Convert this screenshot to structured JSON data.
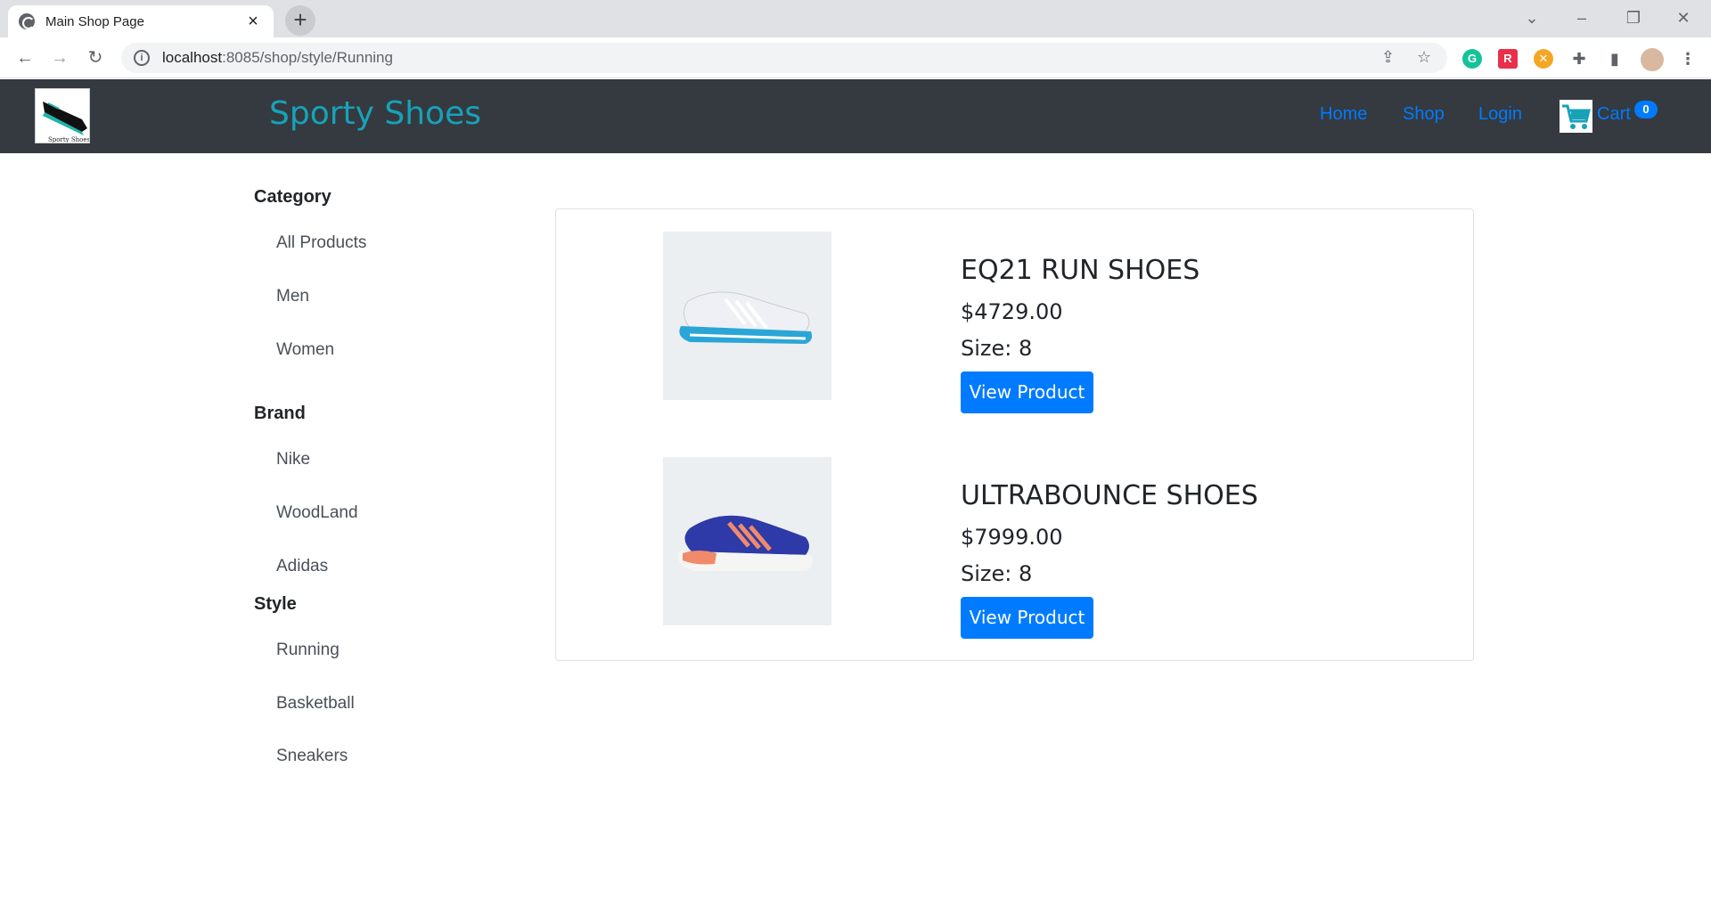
{
  "browser": {
    "tab_title": "Main Shop Page",
    "url_host": "localhost",
    "url_rest": ":8085/shop/style/Running",
    "colors": {
      "tabstrip": "#dfe1e5",
      "omnibox": "#f1f3f4"
    },
    "extensions": [
      {
        "name": "grammarly-icon",
        "glyph": "G",
        "color": "#15c39a"
      },
      {
        "name": "extension-red-icon",
        "glyph": "R",
        "color": "#e8304a"
      },
      {
        "name": "extension-yellow-icon",
        "glyph": "✕",
        "color": "#f5a623"
      }
    ]
  },
  "site": {
    "brand": "Sporty Shoes",
    "logo_caption": "Sporty Shoes",
    "nav": {
      "home": "Home",
      "shop": "Shop",
      "login": "Login",
      "cart": "Cart"
    },
    "cart_count": "0",
    "colors": {
      "navbar": "#343a40",
      "brand": "#17a2b8",
      "link": "#007bff",
      "cart_icon": "#17a2b8"
    }
  },
  "sidebar": {
    "category": {
      "heading": "Category",
      "items": [
        "All Products",
        "Men",
        "Women"
      ]
    },
    "brand": {
      "heading": "Brand",
      "items": [
        "Nike",
        "WoodLand",
        "Adidas"
      ]
    },
    "style": {
      "heading": "Style",
      "items": [
        "Running",
        "Basketball",
        "Sneakers"
      ]
    }
  },
  "products": [
    {
      "name": "EQ21 RUN SHOES",
      "price": "$4729.00",
      "size": "Size: 8",
      "button": "View Product",
      "image": "white-running-shoe",
      "shoe_colors": {
        "upper": "#eef0f5",
        "accent": "#2aa6d6",
        "stripes": "#ffffff"
      }
    },
    {
      "name": "ULTRABOUNCE SHOES",
      "price": "$7999.00",
      "size": "Size: 8",
      "button": "View Product",
      "image": "blue-running-shoe",
      "shoe_colors": {
        "upper": "#2e3aa8",
        "accent": "#f08a6a",
        "stripes": "#f08a6a"
      }
    }
  ]
}
